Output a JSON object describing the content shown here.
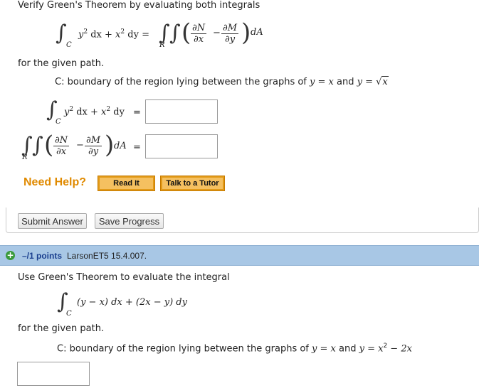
{
  "problem1": {
    "intro": "Verify Green's Theorem by evaluating both integrals",
    "equation": {
      "line_integrand_y2": "y",
      "exp2": "2",
      "dx_plus": "dx + ",
      "x2": "x",
      "dy_eq": "dy =",
      "sub_c": "C",
      "sub_r": "R",
      "dN": "∂N",
      "dx": "∂x",
      "minus": "−",
      "dM": "∂M",
      "dy": "∂y",
      "dA": "dA"
    },
    "given_path": "for the given path.",
    "region_prefix": "C: boundary of the region lying between the graphs of ",
    "region_y1": "y = x",
    "region_and": " and ",
    "region_y2": "y = ",
    "region_sqrt": "x",
    "answer1_eq": "=",
    "answer2_eq": "=",
    "answer1_value": "",
    "answer2_value": "",
    "need_help": "Need Help?",
    "read_it": "Read It",
    "talk_tutor": "Talk to a Tutor",
    "submit": "Submit Answer",
    "save": "Save Progress"
  },
  "problem2": {
    "points": "–/1 points",
    "source": "LarsonET5 15.4.007.",
    "intro": "Use Green's Theorem to evaluate the integral",
    "integrand": "(y − x) dx + (2x − y) dy",
    "sub_c": "C",
    "given_path": "for the given path.",
    "region_prefix": "C: boundary of the region lying between the graphs of ",
    "region_y1": "y = x",
    "region_and": " and ",
    "region_y2a": "y = x",
    "region_exp": "2",
    "region_y2b": " − 2x",
    "answer_value": ""
  },
  "colors": {
    "help_orange": "#e08a00",
    "header_blue": "#a8c7e5",
    "points_blue": "#1a3f8f"
  }
}
